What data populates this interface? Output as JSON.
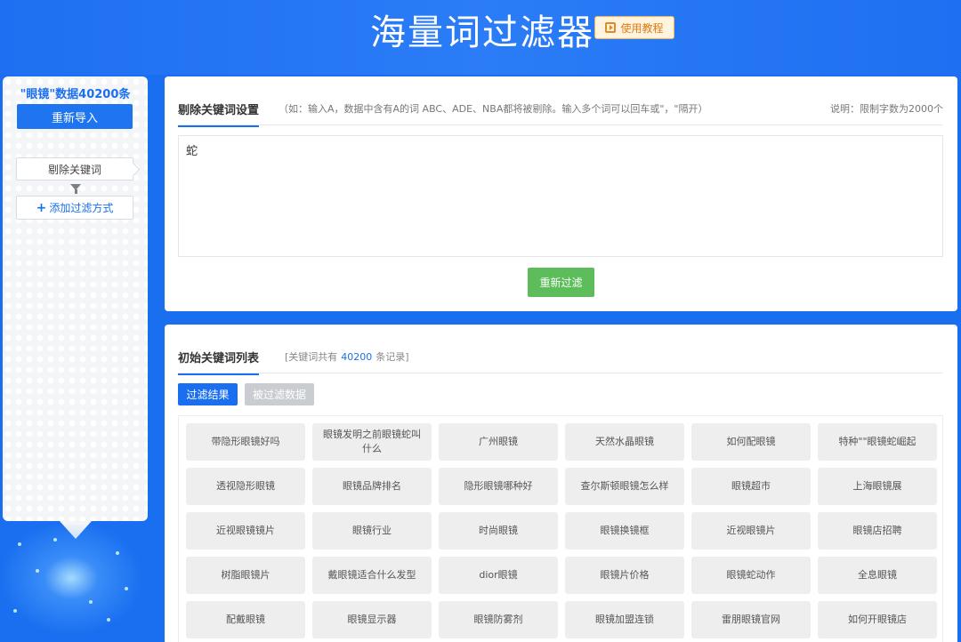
{
  "header": {
    "title": "海量词过滤器",
    "tutorial_label": "使用教程"
  },
  "sidebar": {
    "data_count": "\"眼镜\"数据40200条",
    "reimport_label": "重新导入",
    "steps": [
      {
        "label": "剔除关键词"
      }
    ],
    "add_filter_label": "添加过滤方式"
  },
  "remove_panel": {
    "title": "剔除关键词设置",
    "hint": "（如：输入A，数据中含有A的词 ABC、ADE、NBA都将被剔除。输入多个词可以回车或\"，\"隔开）",
    "note": "说明：限制字数为2000个",
    "textarea_value": "蛇",
    "refilter_label": "重新过滤"
  },
  "list_panel": {
    "title": "初始关键词列表",
    "count_prefix": "[关键词共有",
    "count_value": "40200",
    "count_suffix": "条记录]",
    "tab_result": "过滤结果",
    "tab_filtered": "被过滤数据",
    "keywords": [
      "带隐形眼镜好吗",
      "眼镜发明之前眼镜蛇叫什么",
      "广州眼镜",
      "天然水晶眼镜",
      "如何配眼镜",
      "特种\"\"眼镜蛇崛起",
      "透视隐形眼镜",
      "眼镜品牌排名",
      "隐形眼镜哪种好",
      "查尔斯顿眼镜怎么样",
      "眼镜超市",
      "上海眼镜展",
      "近视眼镜镜片",
      "眼镜行业",
      "时尚眼镜",
      "眼镜换镜框",
      "近视眼镜片",
      "眼镜店招聘",
      "树脂眼镜片",
      "戴眼镜适合什么发型",
      "dior眼镜",
      "眼镜片价格",
      "眼镜蛇动作",
      "全息眼镜",
      "配戴眼镜",
      "眼镜显示器",
      "眼镜防雾剂",
      "眼镜加盟连锁",
      "雷朋眼镜官网",
      "如何开眼镜店"
    ]
  }
}
